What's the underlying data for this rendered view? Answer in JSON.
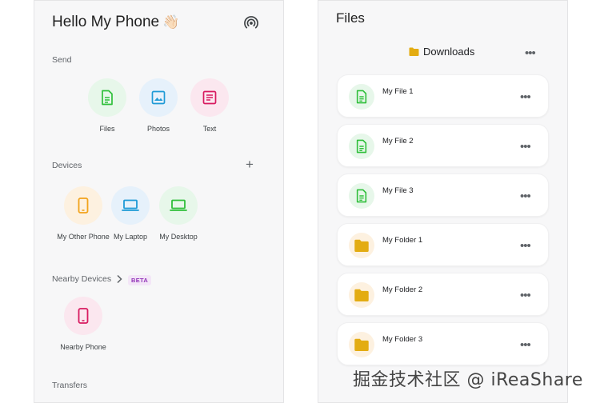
{
  "left": {
    "title": "Hello My Phone",
    "title_emoji": "👋🏻",
    "send_label": "Send",
    "send_items": [
      {
        "label": "Files",
        "icon": "file-icon"
      },
      {
        "label": "Photos",
        "icon": "image-icon"
      },
      {
        "label": "Text",
        "icon": "text-icon"
      }
    ],
    "devices_label": "Devices",
    "devices": [
      {
        "label": "My Other Phone",
        "icon": "phone-icon"
      },
      {
        "label": "My Laptop",
        "icon": "laptop-icon"
      },
      {
        "label": "My Desktop",
        "icon": "laptop-icon"
      }
    ],
    "nearby_label": "Nearby Devices",
    "beta_label": "BETA",
    "nearby": [
      {
        "label": "Nearby Phone",
        "icon": "phone-icon"
      }
    ],
    "transfers_label": "Transfers"
  },
  "right": {
    "title": "Files",
    "folder_name": "Downloads",
    "items": [
      {
        "name": "My File 1",
        "type": "file"
      },
      {
        "name": "My File 2",
        "type": "file"
      },
      {
        "name": "My File 3",
        "type": "file"
      },
      {
        "name": "My Folder 1",
        "type": "folder"
      },
      {
        "name": "My Folder 2",
        "type": "folder"
      },
      {
        "name": "My Folder 3",
        "type": "folder"
      }
    ]
  },
  "watermark": "掘金技术社区 @ iReaShare",
  "colors": {
    "green": "#2fbf3a",
    "blue": "#1e9ad6",
    "pink": "#d81b60",
    "orange": "#f2a31b",
    "folder": "#e3ac12"
  }
}
